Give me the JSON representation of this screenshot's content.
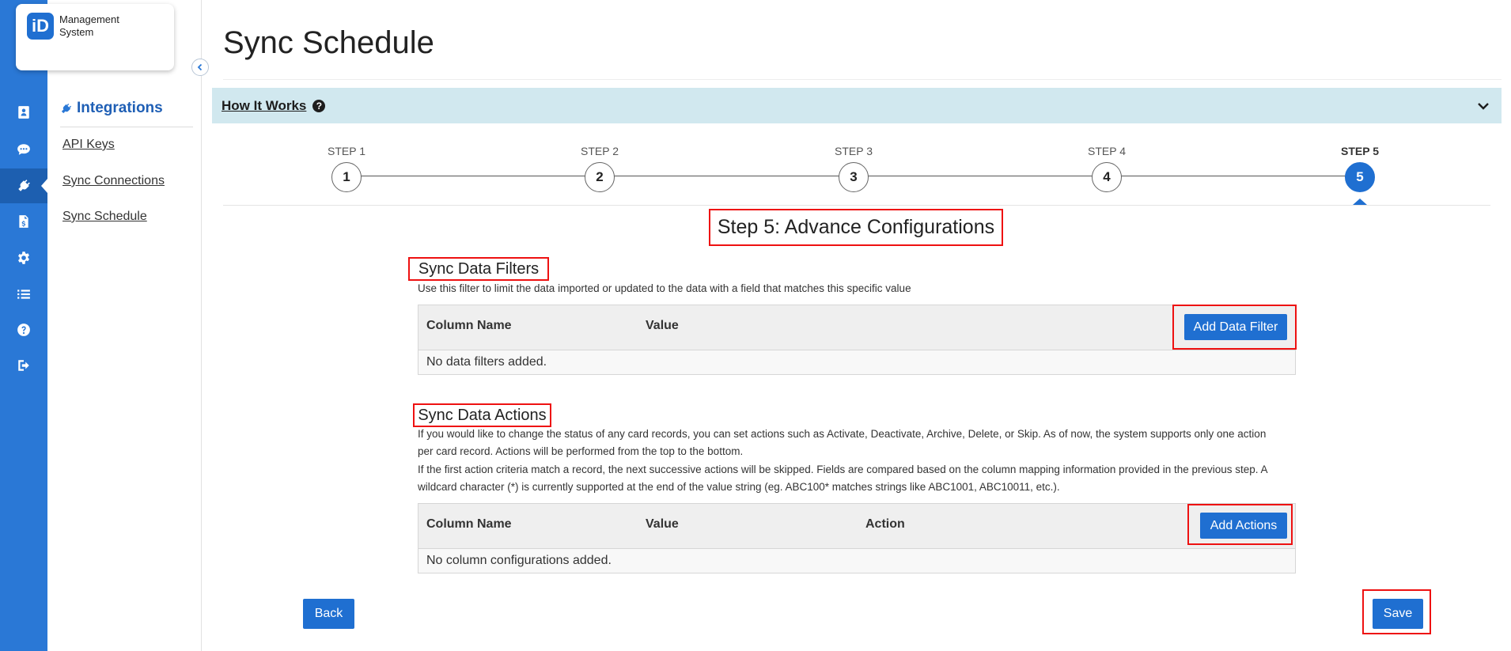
{
  "app": {
    "logo_mark": "iD",
    "logo_text": "Management System"
  },
  "rail": {
    "items": [
      "contacts-icon",
      "chat-icon",
      "plug-icon",
      "document-dollar-icon",
      "gear-icon",
      "list-icon",
      "help-icon",
      "logout-icon"
    ],
    "active_index": 2
  },
  "sidebar": {
    "title": "Integrations",
    "items": [
      {
        "label": "API Keys"
      },
      {
        "label": "Sync Connections"
      },
      {
        "label": "Sync Schedule"
      }
    ]
  },
  "page": {
    "title": "Sync Schedule"
  },
  "how_it_works": {
    "label": "How It Works",
    "help_icon": "?"
  },
  "stepper": {
    "steps": [
      {
        "label": "STEP 1",
        "num": "1"
      },
      {
        "label": "STEP 2",
        "num": "2"
      },
      {
        "label": "STEP 3",
        "num": "3"
      },
      {
        "label": "STEP 4",
        "num": "4"
      },
      {
        "label": "STEP 5",
        "num": "5"
      }
    ],
    "active_step": 5
  },
  "step_heading": "Step 5: Advance Configurations",
  "filters": {
    "title": "Sync Data Filters",
    "description": "Use this filter to limit the data imported or updated to the data with a field that matches this specific value",
    "columns": [
      "Column Name",
      "Value"
    ],
    "add_button": "Add Data Filter",
    "empty_text": "No data filters added."
  },
  "actions": {
    "title": "Sync Data Actions",
    "description_1": "If you would like to change the status of any card records, you can set actions such as Activate, Deactivate, Archive, Delete, or Skip. As of now, the system supports only one action per card record. Actions will be performed from the top to the bottom.",
    "description_2": "If the first action criteria match a record, the next successive actions will be skipped. Fields are compared based on the column mapping information provided in the previous step. A wildcard character (*) is currently supported at the end of the value string (eg. ABC100* matches strings like ABC1001, ABC10011, etc.).",
    "columns": [
      "Column Name",
      "Value",
      "Action"
    ],
    "add_button": "Add Actions",
    "empty_text": "No column configurations added."
  },
  "footer": {
    "back": "Back",
    "save": "Save"
  },
  "colors": {
    "primary": "#1f6fd1",
    "rail": "#2a78d6",
    "banner": "#d1e8ef",
    "highlight": "#e11111"
  }
}
